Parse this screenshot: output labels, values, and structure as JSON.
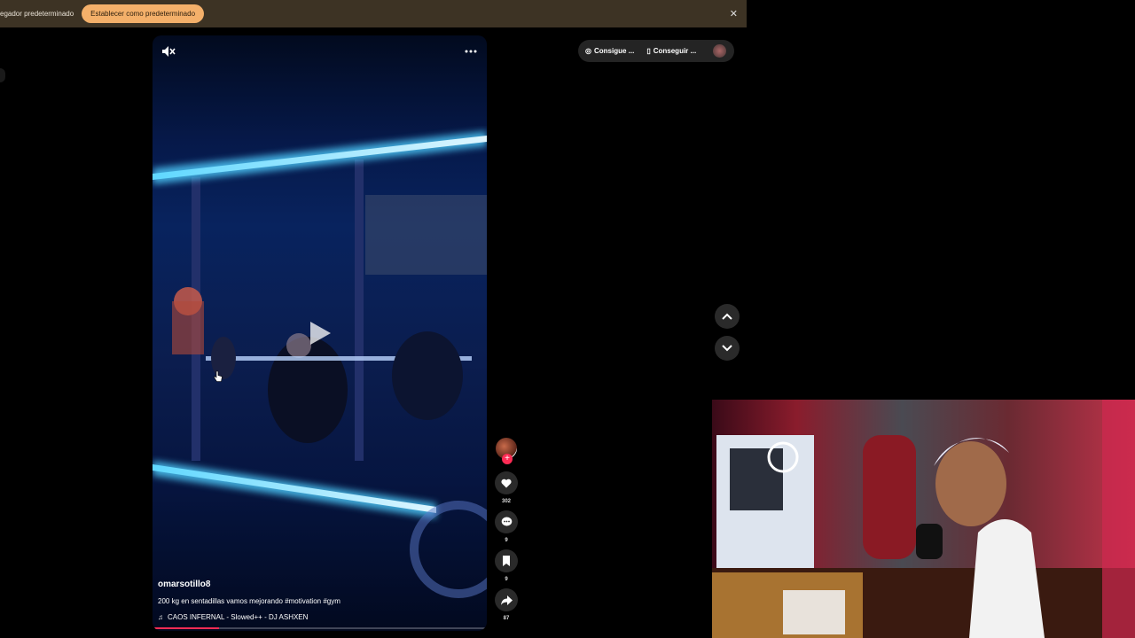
{
  "banner": {
    "message": "egador predeterminado",
    "button_label": "Establecer como predeterminado",
    "close_icon": "close-icon"
  },
  "video": {
    "username": "omarsotillo8",
    "caption": "200 kg en sentadillas vamos mejorando #motivation #gym",
    "music": "CAOS INFERNAL - Slowed++ - DJ ASHXEN",
    "progress": 0.2
  },
  "actions": {
    "likes": "302",
    "comments": "9",
    "saves": "9",
    "shares": "87"
  },
  "top_right": {
    "chip1": "Consigue ...",
    "chip2": "Conseguir ..."
  },
  "colors": {
    "accent": "#fe2c55",
    "banner_button": "#f4b06a",
    "banner_bg": "#3d3324"
  }
}
